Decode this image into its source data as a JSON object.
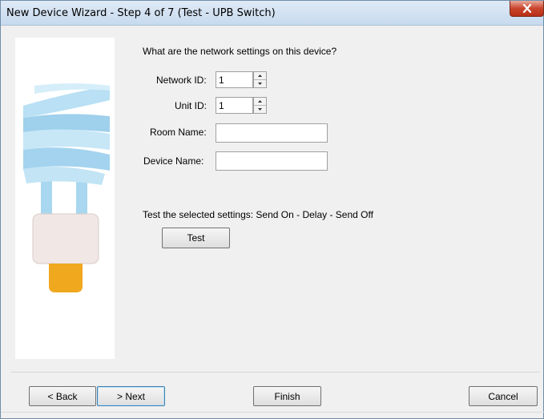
{
  "window": {
    "title": "New Device Wizard - Step 4 of 7 (Test - UPB Switch)"
  },
  "prompt": "What are the network settings on this device?",
  "fields": {
    "network_id_label": "Network ID:",
    "network_id_value": "1",
    "unit_id_label": "Unit ID:",
    "unit_id_value": "1",
    "room_name_label": "Room Name:",
    "room_name_value": "",
    "device_name_label": "Device Name:",
    "device_name_value": ""
  },
  "test": {
    "description": "Test the selected settings: Send On - Delay - Send Off",
    "button_label": "Test"
  },
  "footer": {
    "back_label": "< Back",
    "next_label": "> Next",
    "finish_label": "Finish",
    "cancel_label": "Cancel"
  },
  "icons": {
    "close": "close-icon",
    "illustration": "light-bulb-icon",
    "spinner_up": "spinner-up-icon",
    "spinner_down": "spinner-down-icon"
  },
  "colors": {
    "bulb_glass": "#a9d7f0",
    "bulb_base": "#f0e7e4",
    "bulb_tip": "#f0a81e",
    "close_button": "#c9452c"
  }
}
